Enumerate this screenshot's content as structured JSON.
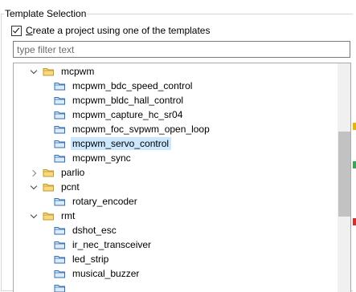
{
  "group": {
    "title": "Template Selection"
  },
  "checkbox": {
    "prefix": "",
    "mnemonic": "C",
    "rest": "reate a project using one of the templates",
    "checked": true
  },
  "filter": {
    "placeholder": "type filter text",
    "value": ""
  },
  "tree": {
    "selected_index": 5,
    "rows": [
      {
        "label": "mcpwm",
        "kind": "folder",
        "expanded": true
      },
      {
        "label": "mcpwm_bdc_speed_control",
        "kind": "project"
      },
      {
        "label": "mcpwm_bldc_hall_control",
        "kind": "project"
      },
      {
        "label": "mcpwm_capture_hc_sr04",
        "kind": "project"
      },
      {
        "label": "mcpwm_foc_svpwm_open_loop",
        "kind": "project"
      },
      {
        "label": "mcpwm_servo_control",
        "kind": "project"
      },
      {
        "label": "mcpwm_sync",
        "kind": "project"
      },
      {
        "label": "parlio",
        "kind": "folder",
        "expanded": false
      },
      {
        "label": "pcnt",
        "kind": "folder",
        "expanded": true
      },
      {
        "label": "rotary_encoder",
        "kind": "project"
      },
      {
        "label": "rmt",
        "kind": "folder",
        "expanded": true
      },
      {
        "label": "dshot_esc",
        "kind": "project"
      },
      {
        "label": "ir_nec_transceiver",
        "kind": "project"
      },
      {
        "label": "led_strip",
        "kind": "project"
      },
      {
        "label": "musical_buzzer",
        "kind": "project"
      }
    ]
  },
  "colors": {
    "selection": "#cce8ff",
    "folder_fill": "#f7d77f",
    "folder_stroke": "#c59a2a",
    "project_fill": "#dcebf7",
    "project_stroke": "#2e6fb7"
  }
}
